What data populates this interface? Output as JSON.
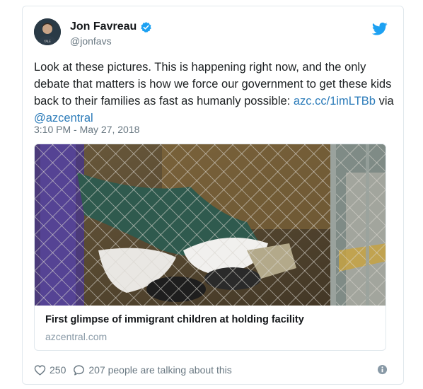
{
  "tweet": {
    "author_name": "Jon Favreau",
    "author_handle": "@jonfavs",
    "text": "Look at these pictures. This is happening right now, and the only debate that matters is how we force our government to get these kids back to their families as fast as humanly possible: ",
    "link": "azc.cc/1imLTBb",
    "via_text": " via ",
    "mention": "@azcentral",
    "timestamp": "3:10 PM - May 27, 2018"
  },
  "card": {
    "title": "First glimpse of immigrant children at holding facility",
    "domain": "azcentral.com"
  },
  "footer": {
    "likes": "250",
    "talking": "207 people are talking about this"
  },
  "icons": {
    "verified": "verified-badge-icon",
    "twitter": "twitter-bird-icon",
    "like": "heart-icon",
    "reply": "reply-bubble-icon",
    "info": "info-icon"
  },
  "colors": {
    "link": "#2b7bb9",
    "twitter_blue": "#1da1f2",
    "muted": "#697882",
    "border": "#e1e8ed"
  }
}
